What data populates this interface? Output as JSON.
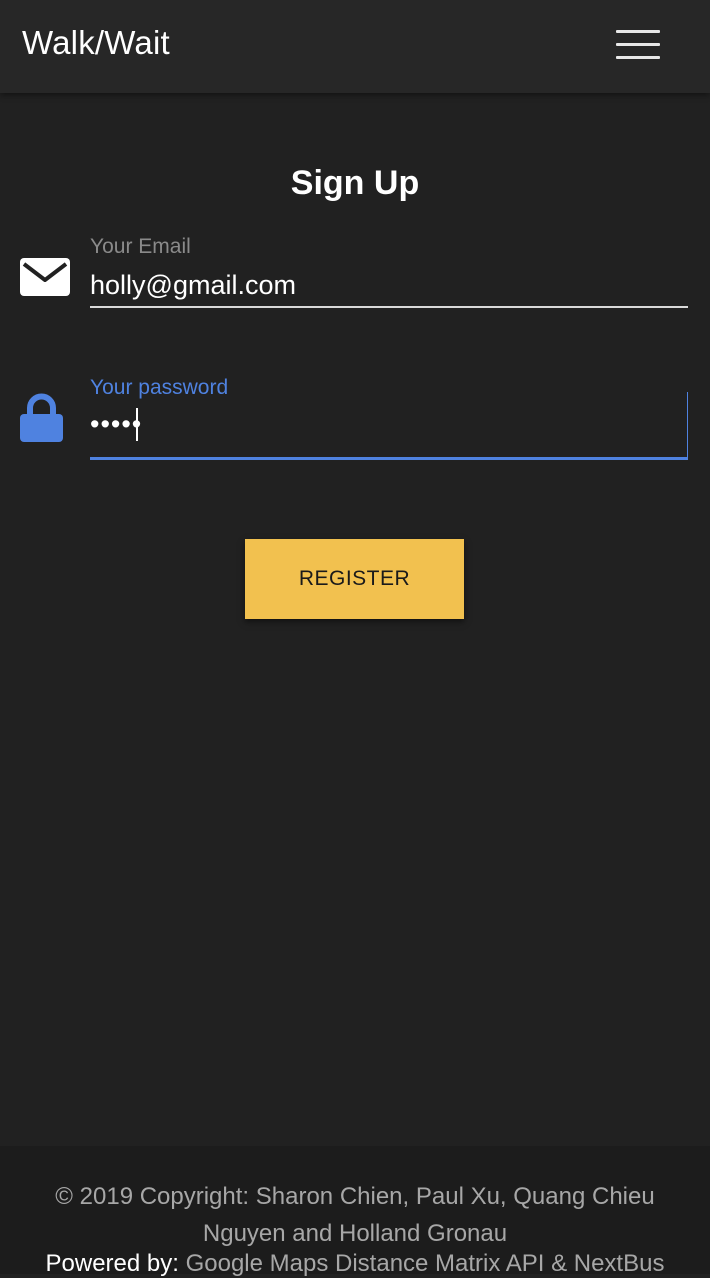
{
  "header": {
    "brand": "Walk/Wait",
    "menu_icon": "hamburger-menu-icon"
  },
  "main": {
    "title": "Sign Up",
    "email": {
      "icon": "envelope-icon",
      "label": "Your Email",
      "value": "holly@gmail.com"
    },
    "password": {
      "icon": "lock-icon",
      "label": "Your password",
      "value": "•••••"
    },
    "register_label": "REGISTER"
  },
  "footer": {
    "copyright": "© 2019 Copyright: Sharon Chien, Paul Xu, Quang Chieu Nguyen and Holland Gronau",
    "powered_label": "Powered by:",
    "powered_link": "Google Maps Distance Matrix API & NextBus"
  },
  "colors": {
    "background": "#212121",
    "navbar": "#272727",
    "accent_blue": "#4f82e0",
    "button_yellow": "#f2c14f"
  }
}
